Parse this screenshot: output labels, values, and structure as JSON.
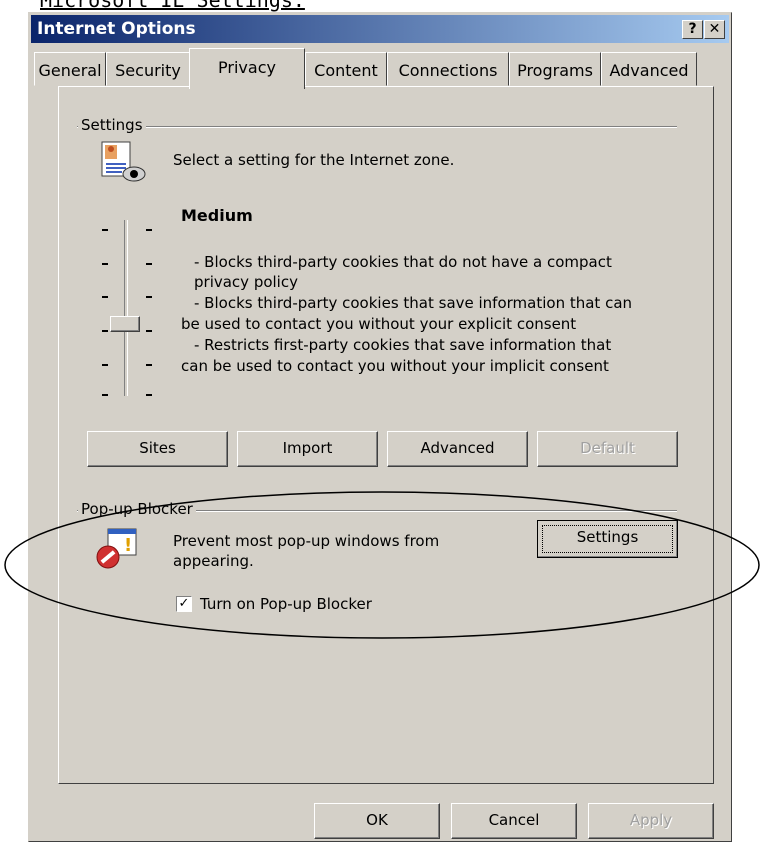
{
  "caption": "Microsoft IE Settings:",
  "window": {
    "title": "Internet Options",
    "help_label": "?",
    "close_label": "✕"
  },
  "tabs": [
    {
      "label": "General"
    },
    {
      "label": "Security"
    },
    {
      "label": "Privacy",
      "active": true
    },
    {
      "label": "Content"
    },
    {
      "label": "Connections"
    },
    {
      "label": "Programs"
    },
    {
      "label": "Advanced"
    }
  ],
  "settings": {
    "group_label": "Settings",
    "description": "Select a setting for the Internet zone.",
    "level": "Medium",
    "bullets": [
      "- Blocks third-party cookies that do not have a compact",
      "privacy policy",
      "- Blocks third-party cookies that save information that can",
      "be used to contact you without your explicit consent",
      "- Restricts first-party cookies that save information that",
      "can be used to contact you without your implicit consent"
    ],
    "slider_level": 3,
    "slider_levels": 6,
    "buttons": {
      "sites": "Sites",
      "import": "Import",
      "advanced": "Advanced",
      "default": "Default"
    }
  },
  "popup": {
    "group_label": "Pop-up Blocker",
    "description_line1": "Prevent most pop-up windows from",
    "description_line2": "appearing.",
    "settings_button": "Settings",
    "checkbox_label": "Turn on Pop-up Blocker",
    "checkbox_checked": true
  },
  "footer": {
    "ok": "OK",
    "cancel": "Cancel",
    "apply": "Apply"
  },
  "colors": {
    "dialog": "#d4d0c8",
    "title_start": "#0a246a",
    "title_end": "#a6caf0"
  }
}
